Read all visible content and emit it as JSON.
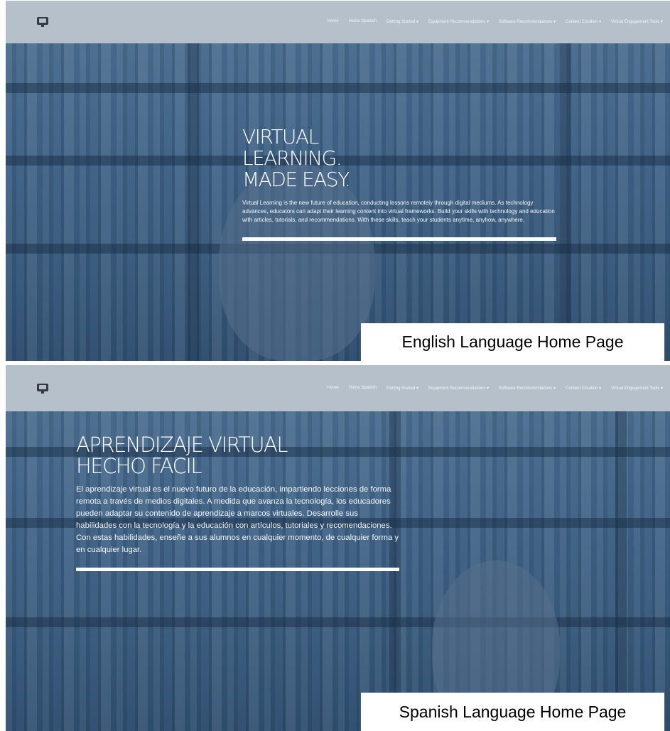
{
  "nav_items": [
    "Home",
    "Home Spanish",
    "Getting Started ▾",
    "Equipment Recommendations ▾",
    "Software Recommendations ▾",
    "Content Creation ▾",
    "Virtual Engagement Tools ▾"
  ],
  "english": {
    "nav": {
      "home": "Home",
      "home_spanish": "Home Spanish",
      "getting_started": "Getting Started ▾",
      "equipment": "Equipment Recommendations ▾",
      "software": "Software Recommendations ▾",
      "content": "Content Creation ▾",
      "engagement": "Virtual Engagement Tools ▾"
    },
    "hero_title_line1": "VIRTUAL",
    "hero_title_line2": "LEARNING.",
    "hero_title_line3": "MADE EASY.",
    "hero_text": "Virtual Learning is the new future of education, conducting lessons remotely through digital mediums. As technology advances, educators can adapt their learning content into virtual frameworks. Build your skills with technology and education with articles, tutorials, and recommendations. With these skills, teach your students anytime, anyhow, anywhere.",
    "caption": "English Language Home Page"
  },
  "spanish": {
    "nav": {
      "home": "Home",
      "home_spanish": "Home Spanish",
      "getting_started": "Getting Started ▾",
      "equipment": "Equipment Recommendations ▾",
      "software": "Software Recommendations ▾",
      "content": "Content Creation ▾",
      "engagement": "Virtual Engagement Tools ▾"
    },
    "hero_title_line1": "APRENDIZAJE VIRTUAL",
    "hero_title_line2": "HECHO FACIL",
    "hero_text": "El aprendizaje virtual es el nuevo futuro de la educación, impartiendo lecciones de forma remota a través de medios digitales. A medida que avanza la tecnología, los educadores pueden adaptar su contenido de aprendizaje a marcos virtuales. Desarrolle sus habilidades con la tecnología y la educación con artículos, tutoriales y recomendaciones. Con estas habilidades, enseñe a sus alumnos en cualquier momento, de cualquier forma y en cualquier lugar.",
    "caption": "Spanish Language Home Page"
  },
  "icons": {
    "logo": "monitor-icon"
  },
  "colors": {
    "navbar_bg": "#b5c0ca",
    "hero_overlay": "#3a5d80",
    "logo": "#343a40"
  }
}
